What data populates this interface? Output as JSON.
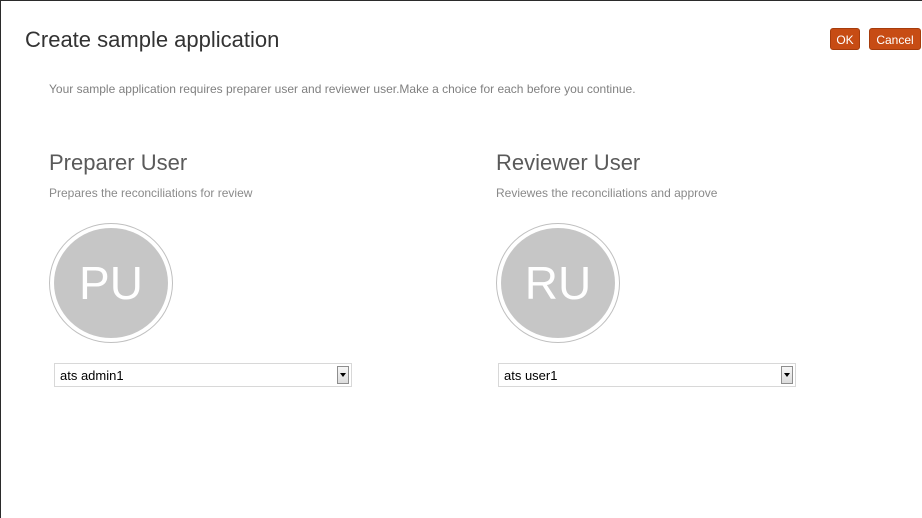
{
  "dialog": {
    "title": "Create sample application",
    "ok_label": "OK",
    "cancel_label": "Cancel",
    "instructions": "Your sample application requires preparer user and reviewer user.Make a choice for each before you continue."
  },
  "preparer": {
    "heading": "Preparer User",
    "description": "Prepares the reconciliations for review",
    "avatar_initials": "PU",
    "selected_user": "ats admin1"
  },
  "reviewer": {
    "heading": "Reviewer User",
    "description": "Reviewes the reconciliations and approve",
    "avatar_initials": "RU",
    "selected_user": "ats user1"
  },
  "colors": {
    "button": "#c74c14",
    "avatar": "#c6c6c6"
  }
}
